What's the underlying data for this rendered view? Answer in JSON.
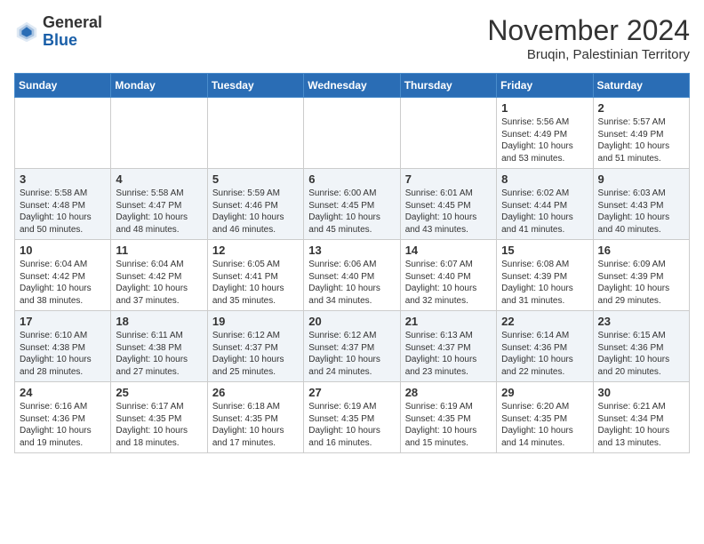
{
  "logo": {
    "general": "General",
    "blue": "Blue"
  },
  "header": {
    "title": "November 2024",
    "location": "Bruqin, Palestinian Territory"
  },
  "weekdays": [
    "Sunday",
    "Monday",
    "Tuesday",
    "Wednesday",
    "Thursday",
    "Friday",
    "Saturday"
  ],
  "weeks": [
    [
      {
        "day": "",
        "content": ""
      },
      {
        "day": "",
        "content": ""
      },
      {
        "day": "",
        "content": ""
      },
      {
        "day": "",
        "content": ""
      },
      {
        "day": "",
        "content": ""
      },
      {
        "day": "1",
        "content": "Sunrise: 5:56 AM\nSunset: 4:49 PM\nDaylight: 10 hours and 53 minutes."
      },
      {
        "day": "2",
        "content": "Sunrise: 5:57 AM\nSunset: 4:49 PM\nDaylight: 10 hours and 51 minutes."
      }
    ],
    [
      {
        "day": "3",
        "content": "Sunrise: 5:58 AM\nSunset: 4:48 PM\nDaylight: 10 hours and 50 minutes."
      },
      {
        "day": "4",
        "content": "Sunrise: 5:58 AM\nSunset: 4:47 PM\nDaylight: 10 hours and 48 minutes."
      },
      {
        "day": "5",
        "content": "Sunrise: 5:59 AM\nSunset: 4:46 PM\nDaylight: 10 hours and 46 minutes."
      },
      {
        "day": "6",
        "content": "Sunrise: 6:00 AM\nSunset: 4:45 PM\nDaylight: 10 hours and 45 minutes."
      },
      {
        "day": "7",
        "content": "Sunrise: 6:01 AM\nSunset: 4:45 PM\nDaylight: 10 hours and 43 minutes."
      },
      {
        "day": "8",
        "content": "Sunrise: 6:02 AM\nSunset: 4:44 PM\nDaylight: 10 hours and 41 minutes."
      },
      {
        "day": "9",
        "content": "Sunrise: 6:03 AM\nSunset: 4:43 PM\nDaylight: 10 hours and 40 minutes."
      }
    ],
    [
      {
        "day": "10",
        "content": "Sunrise: 6:04 AM\nSunset: 4:42 PM\nDaylight: 10 hours and 38 minutes."
      },
      {
        "day": "11",
        "content": "Sunrise: 6:04 AM\nSunset: 4:42 PM\nDaylight: 10 hours and 37 minutes."
      },
      {
        "day": "12",
        "content": "Sunrise: 6:05 AM\nSunset: 4:41 PM\nDaylight: 10 hours and 35 minutes."
      },
      {
        "day": "13",
        "content": "Sunrise: 6:06 AM\nSunset: 4:40 PM\nDaylight: 10 hours and 34 minutes."
      },
      {
        "day": "14",
        "content": "Sunrise: 6:07 AM\nSunset: 4:40 PM\nDaylight: 10 hours and 32 minutes."
      },
      {
        "day": "15",
        "content": "Sunrise: 6:08 AM\nSunset: 4:39 PM\nDaylight: 10 hours and 31 minutes."
      },
      {
        "day": "16",
        "content": "Sunrise: 6:09 AM\nSunset: 4:39 PM\nDaylight: 10 hours and 29 minutes."
      }
    ],
    [
      {
        "day": "17",
        "content": "Sunrise: 6:10 AM\nSunset: 4:38 PM\nDaylight: 10 hours and 28 minutes."
      },
      {
        "day": "18",
        "content": "Sunrise: 6:11 AM\nSunset: 4:38 PM\nDaylight: 10 hours and 27 minutes."
      },
      {
        "day": "19",
        "content": "Sunrise: 6:12 AM\nSunset: 4:37 PM\nDaylight: 10 hours and 25 minutes."
      },
      {
        "day": "20",
        "content": "Sunrise: 6:12 AM\nSunset: 4:37 PM\nDaylight: 10 hours and 24 minutes."
      },
      {
        "day": "21",
        "content": "Sunrise: 6:13 AM\nSunset: 4:37 PM\nDaylight: 10 hours and 23 minutes."
      },
      {
        "day": "22",
        "content": "Sunrise: 6:14 AM\nSunset: 4:36 PM\nDaylight: 10 hours and 22 minutes."
      },
      {
        "day": "23",
        "content": "Sunrise: 6:15 AM\nSunset: 4:36 PM\nDaylight: 10 hours and 20 minutes."
      }
    ],
    [
      {
        "day": "24",
        "content": "Sunrise: 6:16 AM\nSunset: 4:36 PM\nDaylight: 10 hours and 19 minutes."
      },
      {
        "day": "25",
        "content": "Sunrise: 6:17 AM\nSunset: 4:35 PM\nDaylight: 10 hours and 18 minutes."
      },
      {
        "day": "26",
        "content": "Sunrise: 6:18 AM\nSunset: 4:35 PM\nDaylight: 10 hours and 17 minutes."
      },
      {
        "day": "27",
        "content": "Sunrise: 6:19 AM\nSunset: 4:35 PM\nDaylight: 10 hours and 16 minutes."
      },
      {
        "day": "28",
        "content": "Sunrise: 6:19 AM\nSunset: 4:35 PM\nDaylight: 10 hours and 15 minutes."
      },
      {
        "day": "29",
        "content": "Sunrise: 6:20 AM\nSunset: 4:35 PM\nDaylight: 10 hours and 14 minutes."
      },
      {
        "day": "30",
        "content": "Sunrise: 6:21 AM\nSunset: 4:34 PM\nDaylight: 10 hours and 13 minutes."
      }
    ]
  ]
}
